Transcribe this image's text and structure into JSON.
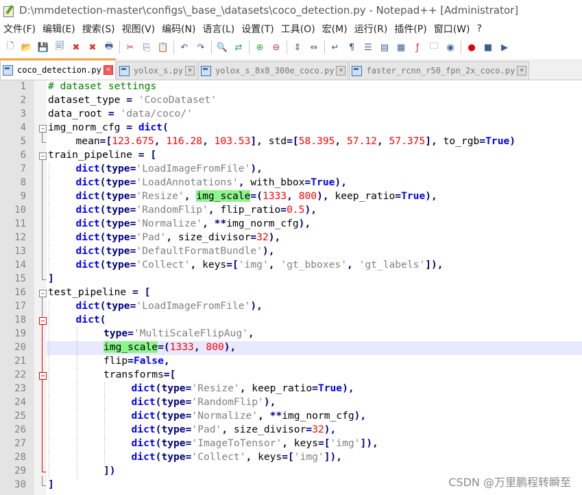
{
  "window": {
    "title": "D:\\mmdetection-master\\configs\\_base_\\datasets\\coco_detection.py - Notepad++ [Administrator]"
  },
  "menu": [
    "文件(F)",
    "编辑(E)",
    "搜索(S)",
    "视图(V)",
    "编码(N)",
    "语言(L)",
    "设置(T)",
    "工具(O)",
    "宏(M)",
    "运行(R)",
    "插件(P)",
    "窗口(W)",
    "?"
  ],
  "toolbar_icons": [
    "new-file-icon",
    "open-folder-icon",
    "save-icon",
    "save-all-icon",
    "close-icon",
    "close-all-icon",
    "print-icon",
    "cut-icon",
    "copy-icon",
    "paste-icon",
    "undo-icon",
    "redo-icon",
    "find-icon",
    "replace-icon",
    "zoom-in-icon",
    "zoom-out-icon",
    "sync-vertical-icon",
    "sync-horizontal-icon",
    "word-wrap-icon",
    "show-all-chars-icon",
    "indent-guide-icon",
    "user-defined-language-icon",
    "document-map-icon",
    "function-list-icon",
    "folder-workspace-icon",
    "monitoring-icon",
    "record-macro-icon",
    "stop-macro-icon",
    "play-macro-icon"
  ],
  "tabs": [
    {
      "label": "coco_detection.py",
      "active": true
    },
    {
      "label": "yolox_s.py",
      "active": false
    },
    {
      "label": "yolox_s_8x8_300e_coco.py",
      "active": false
    },
    {
      "label": "faster_rcnn_r50_fpn_2x_coco.py",
      "active": false
    }
  ],
  "current_line": 20,
  "code_lines": [
    {
      "n": "1",
      "indent": 0,
      "tokens": [
        [
          "cmt",
          "# dataset settings"
        ]
      ]
    },
    {
      "n": "2",
      "indent": 0,
      "tokens": [
        [
          "",
          "dataset_type "
        ],
        [
          "op",
          "="
        ],
        [
          "str",
          " 'CocoDataset'"
        ]
      ]
    },
    {
      "n": "3",
      "indent": 0,
      "tokens": [
        [
          "",
          "data_root "
        ],
        [
          "op",
          "="
        ],
        [
          "str",
          " 'data/coco/'"
        ]
      ]
    },
    {
      "n": "4",
      "indent": 0,
      "tokens": [
        [
          "",
          "img_norm_cfg "
        ],
        [
          "op",
          "="
        ],
        [
          "",
          " "
        ],
        [
          "kw",
          "dict"
        ],
        [
          "op",
          "("
        ]
      ]
    },
    {
      "n": "5",
      "indent": 1,
      "tokens": [
        [
          "",
          "mean"
        ],
        [
          "op",
          "=["
        ],
        [
          "num",
          "123.675"
        ],
        [
          "op",
          ","
        ],
        [
          "",
          " "
        ],
        [
          "num",
          "116.28"
        ],
        [
          "op",
          ","
        ],
        [
          "",
          " "
        ],
        [
          "num",
          "103.53"
        ],
        [
          "op",
          "],"
        ],
        [
          "",
          " std"
        ],
        [
          "op",
          "=["
        ],
        [
          "num",
          "58.395"
        ],
        [
          "op",
          ","
        ],
        [
          "",
          " "
        ],
        [
          "num",
          "57.12"
        ],
        [
          "op",
          ","
        ],
        [
          "",
          " "
        ],
        [
          "num",
          "57.375"
        ],
        [
          "op",
          "],"
        ],
        [
          "",
          " to_rgb"
        ],
        [
          "op",
          "="
        ],
        [
          "kw",
          "True"
        ],
        [
          "op",
          ")"
        ]
      ]
    },
    {
      "n": "6",
      "indent": 0,
      "tokens": [
        [
          "",
          "train_pipeline "
        ],
        [
          "op",
          "="
        ],
        [
          "",
          " "
        ],
        [
          "op",
          "["
        ]
      ]
    },
    {
      "n": "7",
      "indent": 1,
      "tokens": [
        [
          "kw",
          "dict"
        ],
        [
          "op",
          "("
        ],
        [
          "kv",
          "type"
        ],
        [
          "op",
          "="
        ],
        [
          "str",
          "'LoadImageFromFile'"
        ],
        [
          "op",
          "),"
        ]
      ]
    },
    {
      "n": "8",
      "indent": 1,
      "tokens": [
        [
          "kw",
          "dict"
        ],
        [
          "op",
          "("
        ],
        [
          "kv",
          "type"
        ],
        [
          "op",
          "="
        ],
        [
          "str",
          "'LoadAnnotations'"
        ],
        [
          "op",
          ","
        ],
        [
          "",
          " with_bbox"
        ],
        [
          "op",
          "="
        ],
        [
          "kw",
          "True"
        ],
        [
          "op",
          "),"
        ]
      ]
    },
    {
      "n": "9",
      "indent": 1,
      "tokens": [
        [
          "kw",
          "dict"
        ],
        [
          "op",
          "("
        ],
        [
          "kv",
          "type"
        ],
        [
          "op",
          "="
        ],
        [
          "str",
          "'Resize'"
        ],
        [
          "op",
          ","
        ],
        [
          "",
          " "
        ],
        [
          "hl",
          "img_scale"
        ],
        [
          "op",
          "=("
        ],
        [
          "num",
          "1333"
        ],
        [
          "op",
          ","
        ],
        [
          "",
          " "
        ],
        [
          "num",
          "800"
        ],
        [
          "op",
          "),"
        ],
        [
          "",
          " keep_ratio"
        ],
        [
          "op",
          "="
        ],
        [
          "kw",
          "True"
        ],
        [
          "op",
          "),"
        ]
      ]
    },
    {
      "n": "10",
      "indent": 1,
      "tokens": [
        [
          "kw",
          "dict"
        ],
        [
          "op",
          "("
        ],
        [
          "kv",
          "type"
        ],
        [
          "op",
          "="
        ],
        [
          "str",
          "'RandomFlip'"
        ],
        [
          "op",
          ","
        ],
        [
          "",
          " flip_ratio"
        ],
        [
          "op",
          "="
        ],
        [
          "num",
          "0.5"
        ],
        [
          "op",
          "),"
        ]
      ]
    },
    {
      "n": "11",
      "indent": 1,
      "tokens": [
        [
          "kw",
          "dict"
        ],
        [
          "op",
          "("
        ],
        [
          "kv",
          "type"
        ],
        [
          "op",
          "="
        ],
        [
          "str",
          "'Normalize'"
        ],
        [
          "op",
          ","
        ],
        [
          "",
          " "
        ],
        [
          "op",
          "**"
        ],
        [
          "",
          "img_norm_cfg"
        ],
        [
          "op",
          "),"
        ]
      ]
    },
    {
      "n": "12",
      "indent": 1,
      "tokens": [
        [
          "kw",
          "dict"
        ],
        [
          "op",
          "("
        ],
        [
          "kv",
          "type"
        ],
        [
          "op",
          "="
        ],
        [
          "str",
          "'Pad'"
        ],
        [
          "op",
          ","
        ],
        [
          "",
          " size_divisor"
        ],
        [
          "op",
          "="
        ],
        [
          "num",
          "32"
        ],
        [
          "op",
          "),"
        ]
      ]
    },
    {
      "n": "13",
      "indent": 1,
      "tokens": [
        [
          "kw",
          "dict"
        ],
        [
          "op",
          "("
        ],
        [
          "kv",
          "type"
        ],
        [
          "op",
          "="
        ],
        [
          "str",
          "'DefaultFormatBundle'"
        ],
        [
          "op",
          "),"
        ]
      ]
    },
    {
      "n": "14",
      "indent": 1,
      "tokens": [
        [
          "kw",
          "dict"
        ],
        [
          "op",
          "("
        ],
        [
          "kv",
          "type"
        ],
        [
          "op",
          "="
        ],
        [
          "str",
          "'Collect'"
        ],
        [
          "op",
          ","
        ],
        [
          "",
          " keys"
        ],
        [
          "op",
          "=["
        ],
        [
          "str",
          "'img'"
        ],
        [
          "op",
          ","
        ],
        [
          "",
          " "
        ],
        [
          "str",
          "'gt_bboxes'"
        ],
        [
          "op",
          ","
        ],
        [
          "",
          " "
        ],
        [
          "str",
          "'gt_labels'"
        ],
        [
          "op",
          "]),"
        ]
      ]
    },
    {
      "n": "15",
      "indent": 0,
      "tokens": [
        [
          "op",
          "]"
        ]
      ]
    },
    {
      "n": "16",
      "indent": 0,
      "tokens": [
        [
          "",
          "test_pipeline "
        ],
        [
          "op",
          "="
        ],
        [
          "",
          " "
        ],
        [
          "op",
          "["
        ]
      ]
    },
    {
      "n": "17",
      "indent": 1,
      "tokens": [
        [
          "kw",
          "dict"
        ],
        [
          "op",
          "("
        ],
        [
          "kv",
          "type"
        ],
        [
          "op",
          "="
        ],
        [
          "str",
          "'LoadImageFromFile'"
        ],
        [
          "op",
          "),"
        ]
      ]
    },
    {
      "n": "18",
      "indent": 1,
      "tokens": [
        [
          "kw",
          "dict"
        ],
        [
          "op",
          "("
        ]
      ]
    },
    {
      "n": "19",
      "indent": 2,
      "tokens": [
        [
          "kv",
          "type"
        ],
        [
          "op",
          "="
        ],
        [
          "str",
          "'MultiScaleFlipAug'"
        ],
        [
          "op",
          ","
        ]
      ]
    },
    {
      "n": "20",
      "indent": 2,
      "tokens": [
        [
          "hl",
          "img_scale"
        ],
        [
          "op",
          "=("
        ],
        [
          "num",
          "1333"
        ],
        [
          "op",
          ","
        ],
        [
          "",
          " "
        ],
        [
          "num",
          "800"
        ],
        [
          "op",
          "),"
        ]
      ]
    },
    {
      "n": "21",
      "indent": 2,
      "tokens": [
        [
          "",
          "flip"
        ],
        [
          "op",
          "="
        ],
        [
          "kw",
          "False"
        ],
        [
          "op",
          ","
        ]
      ]
    },
    {
      "n": "22",
      "indent": 2,
      "tokens": [
        [
          "",
          "transforms"
        ],
        [
          "op",
          "=["
        ]
      ]
    },
    {
      "n": "23",
      "indent": 3,
      "tokens": [
        [
          "kw",
          "dict"
        ],
        [
          "op",
          "("
        ],
        [
          "kv",
          "type"
        ],
        [
          "op",
          "="
        ],
        [
          "str",
          "'Resize'"
        ],
        [
          "op",
          ","
        ],
        [
          "",
          " keep_ratio"
        ],
        [
          "op",
          "="
        ],
        [
          "kw",
          "True"
        ],
        [
          "op",
          "),"
        ]
      ]
    },
    {
      "n": "24",
      "indent": 3,
      "tokens": [
        [
          "kw",
          "dict"
        ],
        [
          "op",
          "("
        ],
        [
          "kv",
          "type"
        ],
        [
          "op",
          "="
        ],
        [
          "str",
          "'RandomFlip'"
        ],
        [
          "op",
          "),"
        ]
      ]
    },
    {
      "n": "25",
      "indent": 3,
      "tokens": [
        [
          "kw",
          "dict"
        ],
        [
          "op",
          "("
        ],
        [
          "kv",
          "type"
        ],
        [
          "op",
          "="
        ],
        [
          "str",
          "'Normalize'"
        ],
        [
          "op",
          ","
        ],
        [
          "",
          " "
        ],
        [
          "op",
          "**"
        ],
        [
          "",
          "img_norm_cfg"
        ],
        [
          "op",
          "),"
        ]
      ]
    },
    {
      "n": "26",
      "indent": 3,
      "tokens": [
        [
          "kw",
          "dict"
        ],
        [
          "op",
          "("
        ],
        [
          "kv",
          "type"
        ],
        [
          "op",
          "="
        ],
        [
          "str",
          "'Pad'"
        ],
        [
          "op",
          ","
        ],
        [
          "",
          " size_divisor"
        ],
        [
          "op",
          "="
        ],
        [
          "num",
          "32"
        ],
        [
          "op",
          "),"
        ]
      ]
    },
    {
      "n": "27",
      "indent": 3,
      "tokens": [
        [
          "kw",
          "dict"
        ],
        [
          "op",
          "("
        ],
        [
          "kv",
          "type"
        ],
        [
          "op",
          "="
        ],
        [
          "str",
          "'ImageToTensor'"
        ],
        [
          "op",
          ","
        ],
        [
          "",
          " keys"
        ],
        [
          "op",
          "=["
        ],
        [
          "str",
          "'img'"
        ],
        [
          "op",
          "]),"
        ]
      ]
    },
    {
      "n": "28",
      "indent": 3,
      "tokens": [
        [
          "kw",
          "dict"
        ],
        [
          "op",
          "("
        ],
        [
          "kv",
          "type"
        ],
        [
          "op",
          "="
        ],
        [
          "str",
          "'Collect'"
        ],
        [
          "op",
          ","
        ],
        [
          "",
          " keys"
        ],
        [
          "op",
          "=["
        ],
        [
          "str",
          "'img'"
        ],
        [
          "op",
          "]),"
        ]
      ]
    },
    {
      "n": "29",
      "indent": 2,
      "tokens": [
        [
          "op",
          "])"
        ]
      ]
    },
    {
      "n": "30",
      "indent": 0,
      "tokens": [
        [
          "op",
          "]"
        ]
      ]
    }
  ],
  "watermark": "CSDN @万里鹏程转瞬至",
  "colors": {
    "keyword": "#0000ff",
    "string": "#808080",
    "number": "#ff0000",
    "comment": "#008000",
    "operator": "#000080",
    "highlight": "#8cf58c",
    "caret_line": "#e8e8ff",
    "tab_accent": "#f4a340"
  }
}
